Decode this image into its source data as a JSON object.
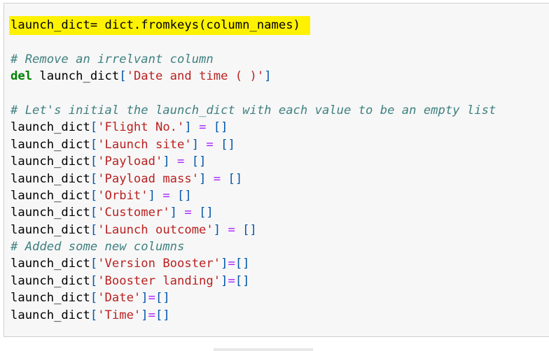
{
  "lines": [
    {
      "type": "hl",
      "parts": [
        "launch_dict= dict.fromkeys(column_names)"
      ]
    },
    {
      "type": "blank"
    },
    {
      "type": "comment",
      "text": "# Remove an irrelvant column"
    },
    {
      "type": "del",
      "kw": "del",
      "var": " launch_dict[",
      "key": "'Date and time ( )'",
      "end": "]"
    },
    {
      "type": "blank"
    },
    {
      "type": "comment",
      "text": "# Let's initial the launch_dict with each value to be an empty list"
    },
    {
      "type": "assign",
      "var": "launch_dict",
      "key": "'Flight No.'",
      "sep": " = "
    },
    {
      "type": "assign",
      "var": "launch_dict",
      "key": "'Launch site'",
      "sep": " = "
    },
    {
      "type": "assign",
      "var": "launch_dict",
      "key": "'Payload'",
      "sep": " = "
    },
    {
      "type": "assign",
      "var": "launch_dict",
      "key": "'Payload mass'",
      "sep": " = "
    },
    {
      "type": "assign",
      "var": "launch_dict",
      "key": "'Orbit'",
      "sep": " = "
    },
    {
      "type": "assign",
      "var": "launch_dict",
      "key": "'Customer'",
      "sep": " = "
    },
    {
      "type": "assign",
      "var": "launch_dict",
      "key": "'Launch outcome'",
      "sep": " = "
    },
    {
      "type": "comment",
      "text": "# Added some new columns"
    },
    {
      "type": "assign",
      "var": "launch_dict",
      "key": "'Version Booster'",
      "sep": "="
    },
    {
      "type": "assign",
      "var": "launch_dict",
      "key": "'Booster landing'",
      "sep": "="
    },
    {
      "type": "assign",
      "var": "launch_dict",
      "key": "'Date'",
      "sep": "="
    },
    {
      "type": "assign",
      "var": "launch_dict",
      "key": "'Time'",
      "sep": "="
    }
  ],
  "colors": {
    "highlight": "#fff200",
    "keyword": "#008000",
    "comment": "#408080",
    "string": "#ba2121",
    "operator": "#aa22ff",
    "bracket": "#0055aa"
  }
}
